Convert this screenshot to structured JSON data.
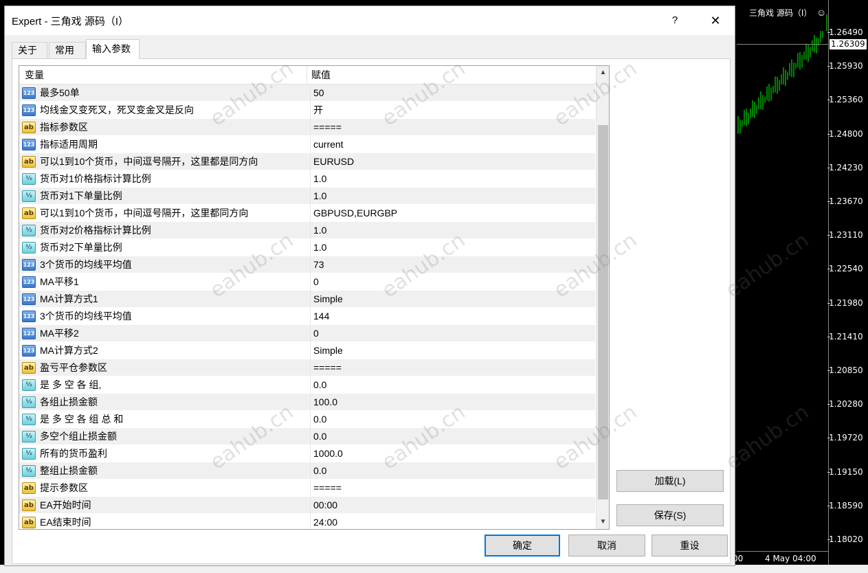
{
  "chart": {
    "title": "三角戏 源码（I）",
    "price_ticks": [
      "1.26490",
      "1.25930",
      "1.25360",
      "1.24800",
      "1.24230",
      "1.23670",
      "1.23110",
      "1.22540",
      "1.21980",
      "1.21410",
      "1.20850",
      "1.20280",
      "1.19720",
      "1.19150",
      "1.18590",
      "1.18020"
    ],
    "current_price": "1.26309",
    "time_labels": [
      "00",
      "4 May 04:00"
    ],
    "candle_color": "#00ff00"
  },
  "dialog": {
    "title": "Expert - 三角戏 源码（I）",
    "help_label": "?",
    "close_label": "✕",
    "tabs": [
      {
        "label": "关于"
      },
      {
        "label": "常用"
      },
      {
        "label": "输入参数"
      }
    ],
    "table": {
      "col_variable": "变量",
      "col_value": "赋值",
      "rows": [
        {
          "icon": "int",
          "name": "最多50单",
          "value": "50"
        },
        {
          "icon": "int",
          "name": "均线金叉变死叉，死叉变金叉是反向",
          "value": "开"
        },
        {
          "icon": "str",
          "name": "指标参数区",
          "value": "====="
        },
        {
          "icon": "int",
          "name": "指标适用周期",
          "value": "current"
        },
        {
          "icon": "str",
          "name": "可以1到10个货币，中间逗号隔开，这里都是同方向",
          "value": "EURUSD"
        },
        {
          "icon": "dbl",
          "name": "货币对1价格指标计算比例",
          "value": "1.0"
        },
        {
          "icon": "dbl",
          "name": "货币对1下单量比例",
          "value": "1.0"
        },
        {
          "icon": "str",
          "name": "可以1到10个货币，中间逗号隔开，这里都同方向",
          "value": "GBPUSD,EURGBP"
        },
        {
          "icon": "dbl",
          "name": "货币对2价格指标计算比例",
          "value": "1.0"
        },
        {
          "icon": "dbl",
          "name": "货币对2下单量比例",
          "value": "1.0"
        },
        {
          "icon": "int",
          "name": "3个货币的均线平均值",
          "value": "73"
        },
        {
          "icon": "int",
          "name": "MA平移1",
          "value": "0"
        },
        {
          "icon": "int",
          "name": "MA计算方式1",
          "value": "Simple"
        },
        {
          "icon": "int",
          "name": "3个货币的均线平均值",
          "value": "144"
        },
        {
          "icon": "int",
          "name": "MA平移2",
          "value": "0"
        },
        {
          "icon": "int",
          "name": "MA计算方式2",
          "value": "Simple"
        },
        {
          "icon": "str",
          "name": "盈亏平仓参数区",
          "value": "====="
        },
        {
          "icon": "dbl",
          "name": "是 多 空 各 组,",
          "value": "0.0"
        },
        {
          "icon": "dbl",
          "name": "各组止损金额",
          "value": "100.0"
        },
        {
          "icon": "dbl",
          "name": "是 多 空 各 组 总 和",
          "value": "0.0"
        },
        {
          "icon": "dbl",
          "name": "多空个组止损金额",
          "value": "0.0"
        },
        {
          "icon": "dbl",
          "name": "所有的货币盈利",
          "value": "1000.0"
        },
        {
          "icon": "dbl",
          "name": "整组止损金额",
          "value": "0.0"
        },
        {
          "icon": "str",
          "name": "提示参数区",
          "value": "====="
        },
        {
          "icon": "str",
          "name": "EA开始时间",
          "value": "00:00"
        },
        {
          "icon": "str",
          "name": "EA结束时间",
          "value": "24:00"
        }
      ]
    },
    "buttons": {
      "load": "加载(L)",
      "save": "保存(S)",
      "ok": "确定",
      "cancel": "取消",
      "reset": "重设"
    },
    "watermark": "eahub.cn"
  }
}
